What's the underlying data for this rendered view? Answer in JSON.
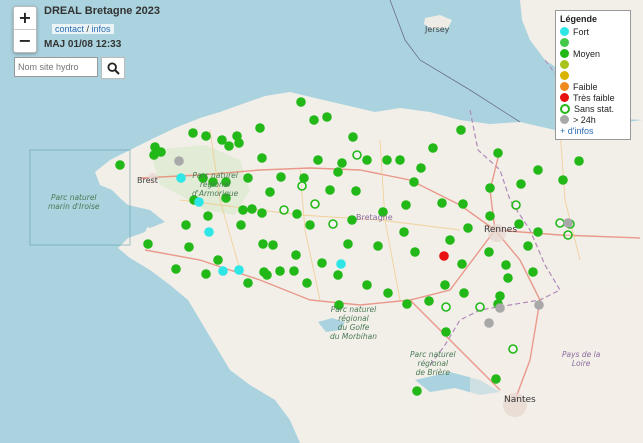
{
  "header": {
    "title": "DREAL Bretagne 2023",
    "contact_label": "contact",
    "separator": " / ",
    "infos_label": "infos",
    "update": "MAJ 01/08 12:33"
  },
  "zoom": {
    "in_label": "+",
    "out_label": "−"
  },
  "search": {
    "placeholder": "Nom site hydro",
    "icon": "search-icon"
  },
  "legend": {
    "title": "Légende",
    "items": [
      {
        "label": "Fort",
        "color": "#2ee6e6",
        "style": "filled"
      },
      {
        "label": "",
        "color": "#44c94a",
        "style": "filled"
      },
      {
        "label": "Moyen",
        "color": "#22b818",
        "style": "filled"
      },
      {
        "label": "",
        "color": "#a8c41c",
        "style": "filled"
      },
      {
        "label": "",
        "color": "#d8b400",
        "style": "filled"
      },
      {
        "label": "Faible",
        "color": "#f08a1c",
        "style": "filled"
      },
      {
        "label": "Très faible",
        "color": "#e81010",
        "style": "filled"
      },
      {
        "label": "Sans stat.",
        "color": "#22b818",
        "style": "ring"
      },
      {
        "label": "> 24h",
        "color": "#a8a8a8",
        "style": "filled"
      }
    ],
    "more_label": "+ d'infos"
  },
  "map_labels": {
    "jersey": "Jersey",
    "brest": "Brest",
    "rennes": "Rennes",
    "bretagne": "Bretagne",
    "nantes": "Nantes",
    "armorique": "Parc naturel\nrégional\nd'Armorique",
    "iroise": "Parc naturel\nmarin d'Iroise",
    "golfe": "Parc naturel\nrégional\ndu Golfe\ndu Morbihan",
    "briere": "Parc naturel\nrégional\nde Brière",
    "loire": "Pays de la\nLoire"
  },
  "stations": [
    {
      "status": "Moyen"
    },
    {
      "status": "Moyen"
    },
    {
      "status": "Moyen"
    },
    {
      "status": "Moyen"
    },
    {
      "status": "Moyen"
    },
    {
      "status": "Fort"
    },
    {
      "status": "Fort"
    },
    {
      "status": "Fort"
    },
    {
      "status": "Fort"
    },
    {
      "status": "Fort"
    },
    {
      "status": "Fort"
    },
    {
      "status": "Très faible"
    },
    {
      "status": "Sans stat."
    },
    {
      "status": "Sans stat."
    },
    {
      "status": "Sans stat."
    },
    {
      "status": "Sans stat."
    },
    {
      "status": "> 24h"
    },
    {
      "status": "> 24h"
    },
    {
      "status": "> 24h"
    },
    {
      "status": "> 24h"
    }
  ]
}
